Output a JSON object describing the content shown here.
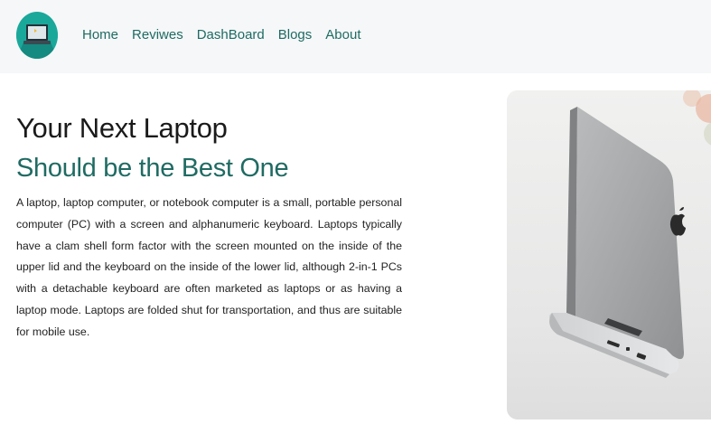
{
  "nav": {
    "logo_icon": "laptop-icon",
    "items": [
      {
        "label": "Home"
      },
      {
        "label": "Reviwes"
      },
      {
        "label": "DashBoard"
      },
      {
        "label": "Blogs"
      },
      {
        "label": "About"
      }
    ]
  },
  "hero": {
    "title": "Your Next Laptop",
    "subtitle": "Should be the Best One",
    "description": "A laptop, laptop computer, or notebook computer is a small, portable personal computer (PC) with a screen and alphanumeric keyboard. Laptops typically have a clam shell form factor with the screen mounted on the inside of the upper lid and the keyboard on the inside of the lower lid, although 2-in-1 PCs with a detachable keyboard are often marketed as laptops or as having a laptop mode. Laptops are folded shut for transportation, and thus are suitable for mobile use.",
    "image_icon": "laptop-photo"
  },
  "colors": {
    "accent": "#1f6b63",
    "logo_bg": "#1aa89b",
    "navbar_bg": "#f5f7f8"
  }
}
